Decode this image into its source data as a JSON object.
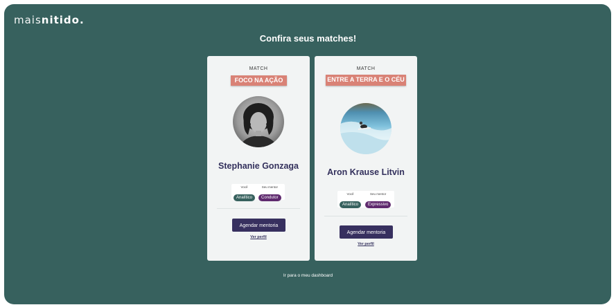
{
  "logo": {
    "light": "mais",
    "bold": "nitido."
  },
  "page_title": "Confira seus matches!",
  "cards": [
    {
      "match_label": "MATCH",
      "badge": "FOCO NA AÇÃO",
      "name": "Stephanie Gonzaga",
      "you_label": "Você",
      "you_value": "Analítico",
      "mentor_label": "Seu mentor",
      "mentor_value": "Condutor",
      "schedule_button": "Agendar mentoria",
      "profile_link": "Ver perfil"
    },
    {
      "match_label": "MATCH",
      "badge": "ENTRE A TERRA E O CÉU",
      "name": "Aron Krause Litvin",
      "you_label": "Você",
      "you_value": "Analítico",
      "mentor_label": "Seu mentor",
      "mentor_value": "Expressivo",
      "schedule_button": "Agendar mentoria",
      "profile_link": "Ver perfil"
    }
  ],
  "dashboard_link": "Ir para o meu dashboard",
  "colors": {
    "background": "#37615e",
    "card": "#f2f4f4",
    "badge": "#d98276",
    "primary_button": "#37305f",
    "you_pill": "#37615e",
    "mentor_pill": "#5f2a6e",
    "name_text": "#33305c"
  }
}
